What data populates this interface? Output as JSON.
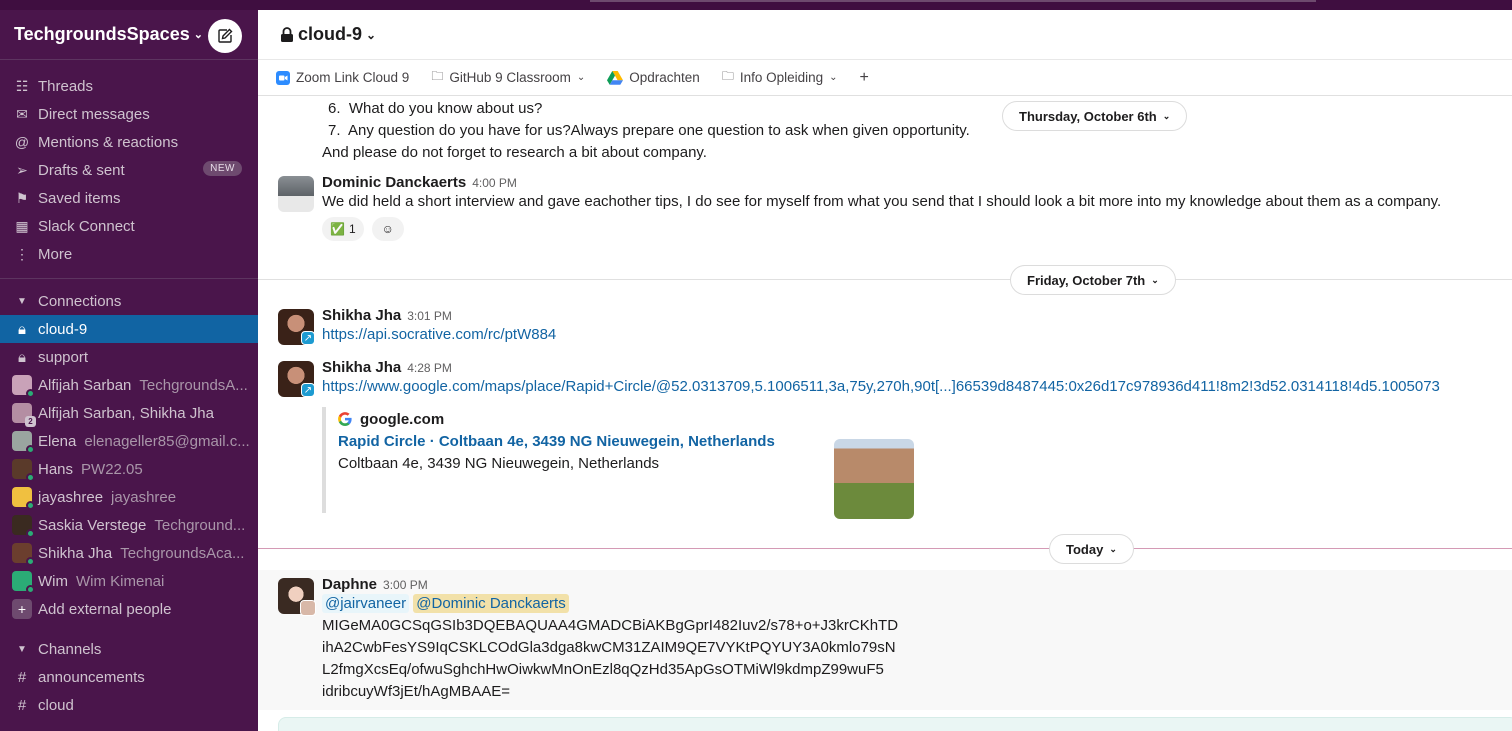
{
  "workspace": {
    "name": "TechgroundsSpaces"
  },
  "nav": [
    {
      "label": "Threads",
      "icon": "threads-icon"
    },
    {
      "label": "Direct messages",
      "icon": "dm-icon"
    },
    {
      "label": "Mentions & reactions",
      "icon": "at-icon"
    },
    {
      "label": "Drafts & sent",
      "icon": "send-icon",
      "badge": "NEW"
    },
    {
      "label": "Saved items",
      "icon": "bookmark-icon"
    },
    {
      "label": "Slack Connect",
      "icon": "building-icon"
    },
    {
      "label": "More",
      "icon": "kebab-icon"
    }
  ],
  "connections": {
    "label": "Connections",
    "items": [
      {
        "label": "cloud-9",
        "type": "locked",
        "active": true
      },
      {
        "label": "support",
        "type": "locked"
      },
      {
        "label": "Alfijah Sarban",
        "sub": "TechgroundsA...",
        "type": "dm",
        "color": "#c9a2b8"
      },
      {
        "label": "Alfijah Sarban, Shikha Jha",
        "type": "group",
        "color": "#b48ea3",
        "count": "2"
      },
      {
        "label": "Elena",
        "sub": "elenageller85@gmail.c...",
        "type": "dm",
        "color": "#9aa5a0"
      },
      {
        "label": "Hans",
        "sub": "PW22.05",
        "type": "dm",
        "color": "#5a3a2a"
      },
      {
        "label": "jayashree",
        "sub": "jayashree",
        "type": "dm",
        "color": "#f0c040"
      },
      {
        "label": "Saskia Verstege",
        "sub": "Techground...",
        "type": "dm",
        "color": "#3a2a20"
      },
      {
        "label": "Shikha Jha",
        "sub": "TechgroundsAca...",
        "type": "dm",
        "color": "#6b3e2e"
      },
      {
        "label": "Wim",
        "sub": "Wim Kimenai",
        "type": "dm",
        "color": "#2bac76"
      }
    ],
    "add_label": "Add external people"
  },
  "channels": {
    "label": "Channels",
    "items": [
      {
        "label": "announcements"
      },
      {
        "label": "cloud"
      }
    ]
  },
  "channel": {
    "name": "cloud-9"
  },
  "bookmarks": [
    {
      "label": "Zoom Link Cloud 9"
    },
    {
      "label": "GitHub 9 Classroom"
    },
    {
      "label": "Opdrachten"
    },
    {
      "label": "Info Opleiding"
    }
  ],
  "messages": {
    "prev_list": [
      {
        "num": "6.",
        "text": "What do you know about us?"
      },
      {
        "num": "7.",
        "text": "Any question do you have for us?Always prepare one question to ask when given opportunity."
      }
    ],
    "prev_footer": "And please do not forget to research a bit about company.",
    "dominic": {
      "sender": "Dominic Danckaerts",
      "time": "4:00 PM",
      "text": "We did held a short interview and gave eachother tips, I do see for myself from what you send that I should look a bit more into my knowledge about them as a company.",
      "reaction_emoji": "✅",
      "reaction_count": "1"
    },
    "shikha1": {
      "sender": "Shikha Jha",
      "time": "3:01 PM",
      "link": "https://api.socrative.com/rc/ptW884"
    },
    "shikha2": {
      "sender": "Shikha Jha",
      "time": "4:28 PM",
      "link": "https://www.google.com/maps/place/Rapid+Circle/@52.0313709,5.1006511,3a,75y,270h,90t[...]66539d8487445:0x26d17c978936d411!8m2!3d52.0314118!4d5.1005073",
      "unfurl_site": "google.com",
      "unfurl_title": "Rapid Circle · Coltbaan 4e, 3439 NG Nieuwegein, Netherlands",
      "unfurl_desc": "Coltbaan 4e, 3439 NG Nieuwegein, Netherlands"
    },
    "daphne": {
      "sender": "Daphne",
      "time": "3:00 PM",
      "mention1": "@jairvaneer",
      "mention2": "@Dominic Danckaerts",
      "lines": [
        "MIGeMA0GCSqGSIb3DQEBAQUAA4GMADCBiAKBgGprI482Iuv2/s78+o+J3krCKhTD",
        "ihA2CwbFesYS9IqCSKLCOdGla3dga8kwCM31ZAIM9QE7VYKtPQYUY3A0kmlo79sN",
        "L2fmgXcsEq/ofwuSghchHwOiwkwMnOnEzl8qQzHd35ApGsOTMiWl9kdmpZ99wuF5",
        "idribcuyWf3jEt/hAgMBAAE="
      ]
    }
  },
  "dates": {
    "thursday": "Thursday, October 6th",
    "friday": "Friday, October 7th",
    "today": "Today"
  }
}
